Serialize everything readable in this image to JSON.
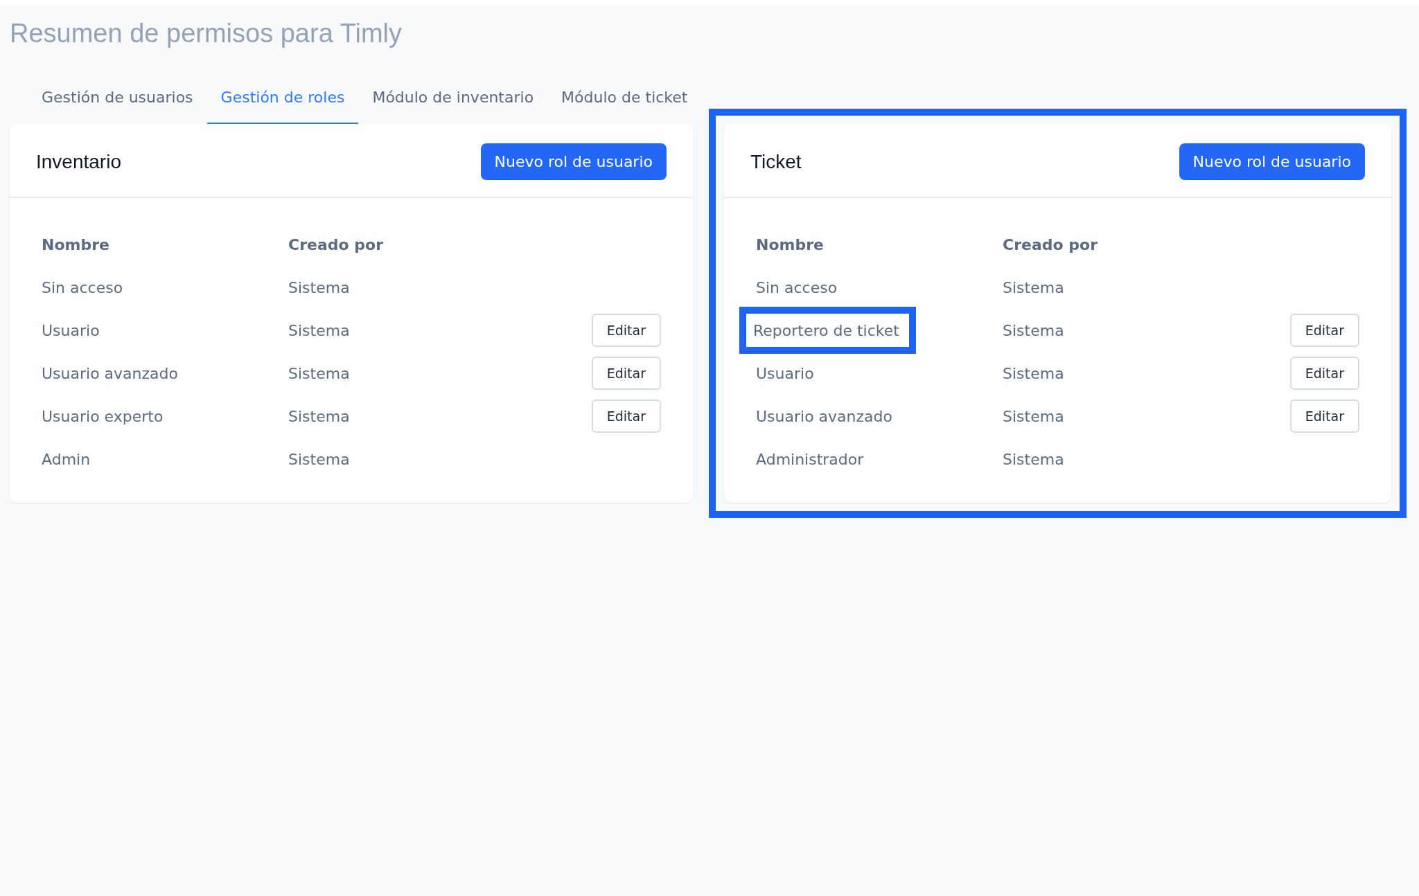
{
  "title": "Resumen de permisos para Timly",
  "tabs": [
    {
      "label": "Gestión de usuarios",
      "selected": false
    },
    {
      "label": "Gestión de roles",
      "selected": true
    },
    {
      "label": "Módulo de inventario",
      "selected": false
    },
    {
      "label": "Módulo de ticket",
      "selected": false
    }
  ],
  "cards": [
    {
      "title": "Inventario",
      "button": "Nuevo rol de usuario",
      "highlighted": false,
      "columns": [
        "Nombre",
        "Creado por"
      ],
      "rows": [
        {
          "name": "Sin acceso",
          "created_by": "Sistema",
          "highlighted": false
        },
        {
          "name": "Usuario",
          "created_by": "Sistema",
          "action": "Editar",
          "highlighted": false
        },
        {
          "name": "Usuario avanzado",
          "created_by": "Sistema",
          "action": "Editar",
          "highlighted": false
        },
        {
          "name": "Usuario experto",
          "created_by": "Sistema",
          "action": "Editar",
          "highlighted": false
        },
        {
          "name": "Admin",
          "created_by": "Sistema",
          "highlighted": false
        }
      ]
    },
    {
      "title": "Ticket",
      "button": "Nuevo rol de usuario",
      "highlighted": true,
      "columns": [
        "Nombre",
        "Creado por"
      ],
      "rows": [
        {
          "name": "Sin acceso",
          "created_by": "Sistema",
          "highlighted": false
        },
        {
          "name": "Reportero de ticket",
          "created_by": "Sistema",
          "action": "Editar",
          "highlighted": true
        },
        {
          "name": "Usuario",
          "created_by": "Sistema",
          "action": "Editar",
          "highlighted": false
        },
        {
          "name": "Usuario avanzado",
          "created_by": "Sistema",
          "action": "Editar",
          "highlighted": false
        },
        {
          "name": "Administrador",
          "created_by": "Sistema",
          "highlighted": false
        }
      ]
    }
  ]
}
